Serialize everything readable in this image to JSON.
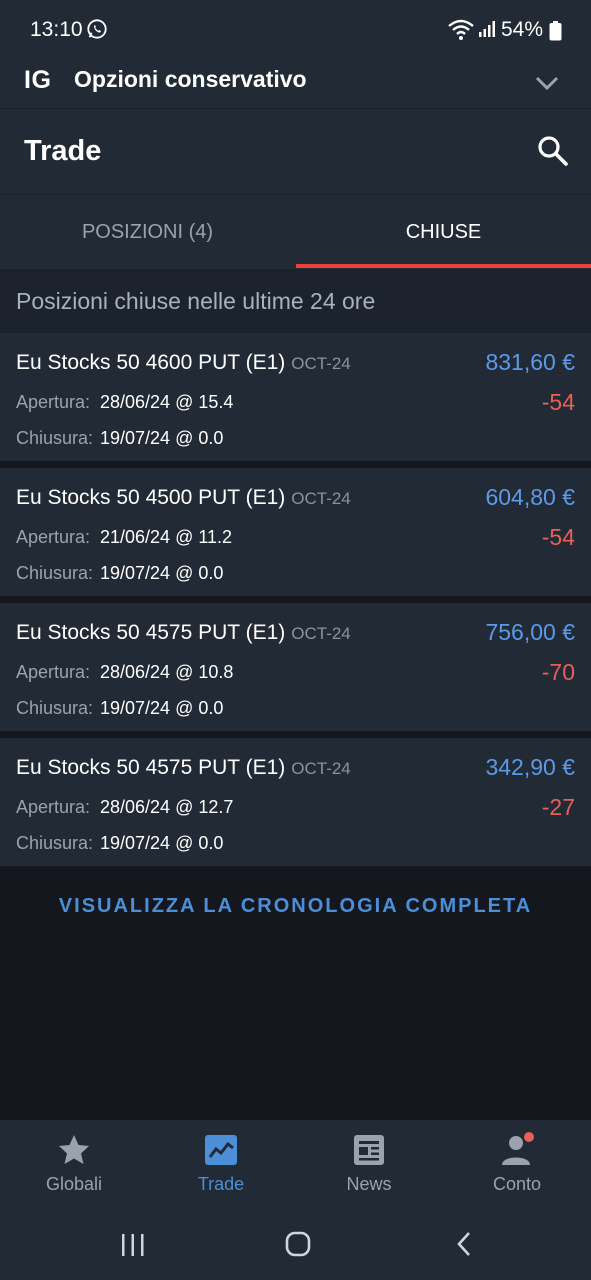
{
  "status": {
    "time": "13:10",
    "battery": "54%"
  },
  "account": {
    "logo": "IG",
    "name": "Opzioni conservativo"
  },
  "header": {
    "title": "Trade"
  },
  "tabs": [
    {
      "label": "POSIZIONI (4)",
      "active": false
    },
    {
      "label": "CHIUSE",
      "active": true
    }
  ],
  "section_title": "Posizioni chiuse nelle ultime 24 ore",
  "labels": {
    "open": "Apertura:",
    "close": "Chiusura:"
  },
  "positions": [
    {
      "instrument": "Eu Stocks 50 4600 PUT (E1)",
      "expiry": "OCT-24",
      "value": "831,60 €",
      "pl": "-54",
      "open": "28/06/24 @ 15.4",
      "close": "19/07/24 @ 0.0"
    },
    {
      "instrument": "Eu Stocks 50 4500 PUT (E1)",
      "expiry": "OCT-24",
      "value": "604,80 €",
      "pl": "-54",
      "open": "21/06/24 @ 11.2",
      "close": "19/07/24 @ 0.0"
    },
    {
      "instrument": "Eu Stocks 50 4575 PUT (E1)",
      "expiry": "OCT-24",
      "value": "756,00 €",
      "pl": "-70",
      "open": "28/06/24 @ 10.8",
      "close": "19/07/24 @ 0.0"
    },
    {
      "instrument": "Eu Stocks 50 4575 PUT (E1)",
      "expiry": "OCT-24",
      "value": "342,90 €",
      "pl": "-27",
      "open": "28/06/24 @ 12.7",
      "close": "19/07/24 @ 0.0"
    }
  ],
  "history_link": "VISUALIZZA LA CRONOLOGIA COMPLETA",
  "bottom_nav": [
    {
      "label": "Globali",
      "icon": "star-icon",
      "active": false
    },
    {
      "label": "Trade",
      "icon": "chart-icon",
      "active": true
    },
    {
      "label": "News",
      "icon": "news-icon",
      "active": false
    },
    {
      "label": "Conto",
      "icon": "account-icon",
      "active": false,
      "badge": true
    }
  ],
  "colors": {
    "accent": "#4c8ed8",
    "negative": "#e8605a",
    "tab_indicator": "#e8403a",
    "background": "#14181e",
    "surface": "#222a35"
  }
}
